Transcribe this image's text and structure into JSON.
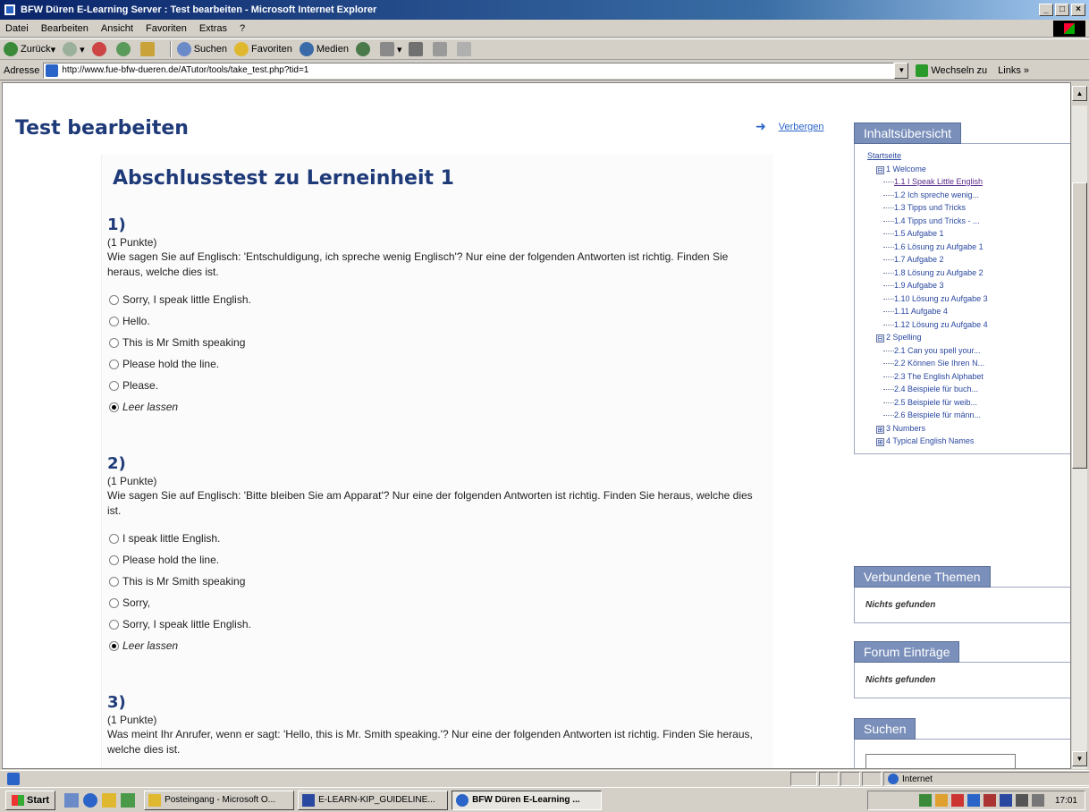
{
  "window": {
    "title": "BFW Düren E-Learning Server : Test bearbeiten - Microsoft Internet Explorer",
    "min": "_",
    "max": "□",
    "close": "×"
  },
  "menu": [
    "Datei",
    "Bearbeiten",
    "Ansicht",
    "Favoriten",
    "Extras",
    "?"
  ],
  "toolbar": {
    "back": "Zurück",
    "search": "Suchen",
    "favorites": "Favoriten",
    "media": "Medien"
  },
  "address": {
    "label": "Adresse",
    "url": "http://www.fue-bfw-dueren.de/ATutor/tools/take_test.php?tid=1",
    "go": "Wechseln zu",
    "links": "Links »"
  },
  "page": {
    "title": "Test bearbeiten",
    "hide": "Verbergen",
    "test_title": "Abschlusstest zu Lerneinheit 1",
    "questions": [
      {
        "num": "1)",
        "points": "(1 Punkte)",
        "text": "Wie sagen Sie auf Englisch: 'Entschuldigung, ich spreche wenig Englisch'? Nur eine der folgenden Antworten ist richtig. Finden Sie heraus, welche dies ist.",
        "options": [
          "Sorry, I speak little English.",
          "Hello.",
          "This is Mr Smith speaking",
          "Please hold the line.",
          "Please.",
          "Leer lassen"
        ]
      },
      {
        "num": "2)",
        "points": "(1 Punkte)",
        "text": "Wie sagen Sie auf Englisch: 'Bitte bleiben Sie am Apparat'? Nur eine der folgenden Antworten ist richtig. Finden Sie heraus, welche dies ist.",
        "options": [
          "I speak little English.",
          "Please hold the line.",
          "This is Mr Smith speaking",
          "Sorry,",
          "Sorry, I speak little English.",
          "Leer lassen"
        ]
      },
      {
        "num": "3)",
        "points": "(1 Punkte)",
        "text": "Was meint Ihr Anrufer, wenn er sagt: 'Hello, this is Mr. Smith speaking.'? Nur eine der folgenden Antworten ist richtig. Finden Sie heraus, welche dies ist.",
        "options": []
      }
    ]
  },
  "sidebar": {
    "toc_head": "Inhaltsübersicht",
    "home": "Startseite",
    "toc": [
      {
        "t": "1 Welcome",
        "lvl": 1,
        "box": "⊟"
      },
      {
        "t": "1.1 I Speak Little English",
        "lvl": 2,
        "cur": true
      },
      {
        "t": "1.2 Ich spreche wenig...",
        "lvl": 2
      },
      {
        "t": "1.3 Tipps und Tricks",
        "lvl": 2
      },
      {
        "t": "1.4 Tipps und Tricks - ...",
        "lvl": 2
      },
      {
        "t": "1.5 Aufgabe 1",
        "lvl": 2
      },
      {
        "t": "1.6 Lösung zu Aufgabe 1",
        "lvl": 2
      },
      {
        "t": "1.7 Aufgabe 2",
        "lvl": 2
      },
      {
        "t": "1.8 Lösung zu Aufgabe 2",
        "lvl": 2
      },
      {
        "t": "1.9 Aufgabe 3",
        "lvl": 2
      },
      {
        "t": "1.10 Lösung zu Aufgabe 3",
        "lvl": 2
      },
      {
        "t": "1.11 Aufgabe 4",
        "lvl": 2
      },
      {
        "t": "1.12 Lösung zu Aufgabe 4",
        "lvl": 2
      },
      {
        "t": "2 Spelling",
        "lvl": 1,
        "box": "⊟"
      },
      {
        "t": "2.1 Can you spell your...",
        "lvl": 2
      },
      {
        "t": "2.2 Können Sie Ihren N...",
        "lvl": 2
      },
      {
        "t": "2.3 The English Alphabet",
        "lvl": 2
      },
      {
        "t": "2.4 Beispiele für buch...",
        "lvl": 2
      },
      {
        "t": "2.5 Beispiele für weib...",
        "lvl": 2
      },
      {
        "t": "2.6 Beispiele für männ...",
        "lvl": 2
      },
      {
        "t": "3 Numbers",
        "lvl": 1,
        "box": "⊞"
      },
      {
        "t": "4 Typical English Names",
        "lvl": 1,
        "box": "⊞"
      }
    ],
    "related_head": "Verbundene Themen",
    "related_empty": "Nichts gefunden",
    "forum_head": "Forum Einträge",
    "forum_empty": "Nichts gefunden",
    "search_head": "Suchen"
  },
  "status": {
    "zone": "Internet"
  },
  "taskbar": {
    "start": "Start",
    "tasks": [
      {
        "label": "Posteingang - Microsoft O..."
      },
      {
        "label": "E-LEARN-KIP_GUIDELINE..."
      },
      {
        "label": "BFW Düren E-Learning ...",
        "active": true
      }
    ],
    "clock": "17:01"
  },
  "colors": {
    "heading": "#1e3a78",
    "panel": "#7a8fba",
    "link": "#2a64c8"
  }
}
